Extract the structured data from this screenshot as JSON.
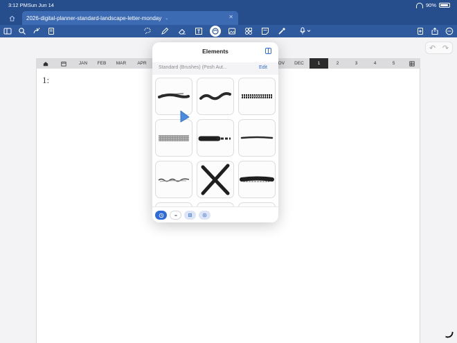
{
  "status": {
    "time": "3:12 PM",
    "date": "Sun Jun 14",
    "battery": "90%",
    "battery_level": 0.9
  },
  "tab": {
    "title": "2026-digital-planner-standard-landscape-letter-monday"
  },
  "toolbar": {
    "left_icons": [
      "sidebar-icon",
      "search-icon",
      "share-link-icon",
      "document-icon"
    ],
    "center_icons": [
      "lasso-icon",
      "pen-icon",
      "eraser-icon",
      "text-box-icon",
      "elements-icon",
      "image-icon",
      "shapes-icon",
      "sticky-note-icon",
      "laser-pointer-icon",
      "microphone-icon"
    ],
    "right_icons": [
      "add-page-icon",
      "export-icon",
      "more-icon"
    ]
  },
  "nav": {
    "months": [
      "JAN",
      "FEB",
      "MAR",
      "APR",
      "NOV",
      "DEC"
    ],
    "days": [
      "1",
      "2",
      "3",
      "4",
      "5"
    ],
    "active_day": "1"
  },
  "page": {
    "day_label": "1:"
  },
  "elements_popover": {
    "title": "Elements",
    "collection": "Standard (Brushes) (Posh Aut...",
    "edit_label": "Edit",
    "tiles": [
      "brush-stroke-1",
      "brush-wave",
      "brush-dotted",
      "brush-textured-band",
      "brush-heavy",
      "brush-thin-line",
      "brush-squiggle",
      "brush-x-mark",
      "brush-dry"
    ],
    "footer": [
      "recent-icon",
      "collapse-icon",
      "grid-icon",
      "add-icon"
    ]
  },
  "colors": {
    "header": "#264d8c",
    "tab": "#3d6bb3",
    "accent": "#2f6bd8",
    "ink": "#2b2b2b"
  }
}
